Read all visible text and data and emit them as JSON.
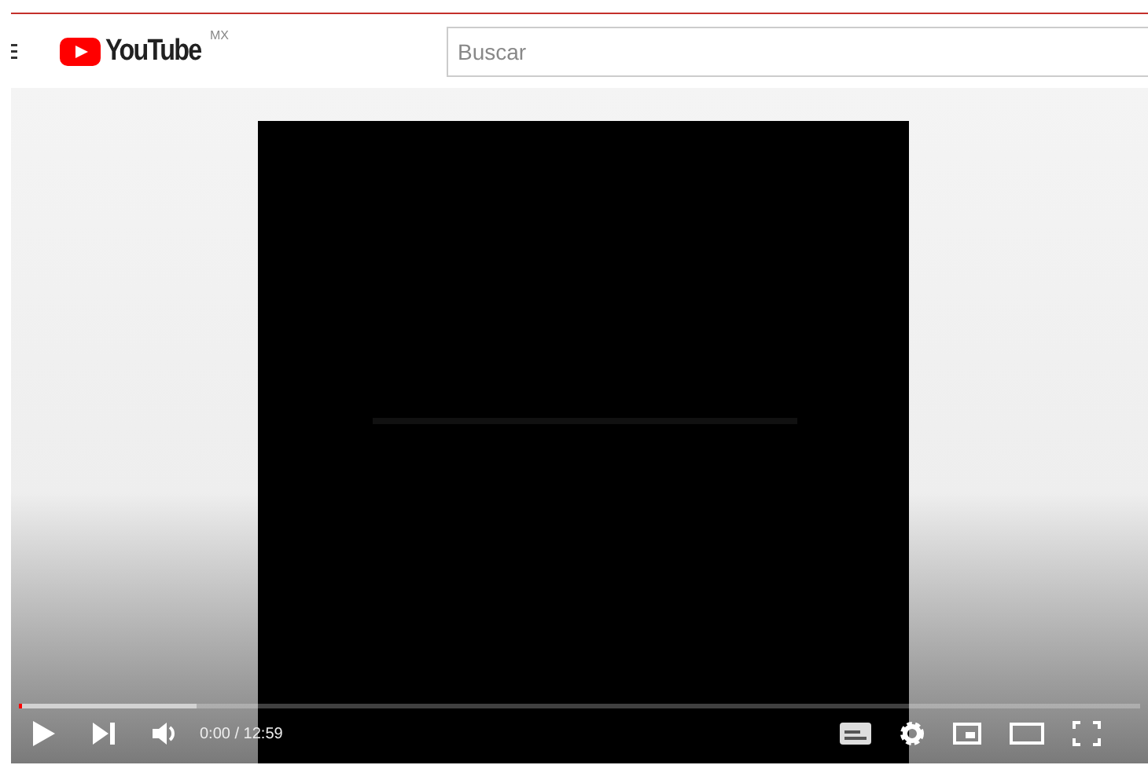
{
  "header": {
    "logo_text": "YouTube",
    "country": "MX",
    "search": {
      "placeholder": "Buscar"
    }
  },
  "player": {
    "progress": {
      "level": 0
    },
    "time": {
      "current": "0:00",
      "total": "/ 12:59"
    }
  }
}
